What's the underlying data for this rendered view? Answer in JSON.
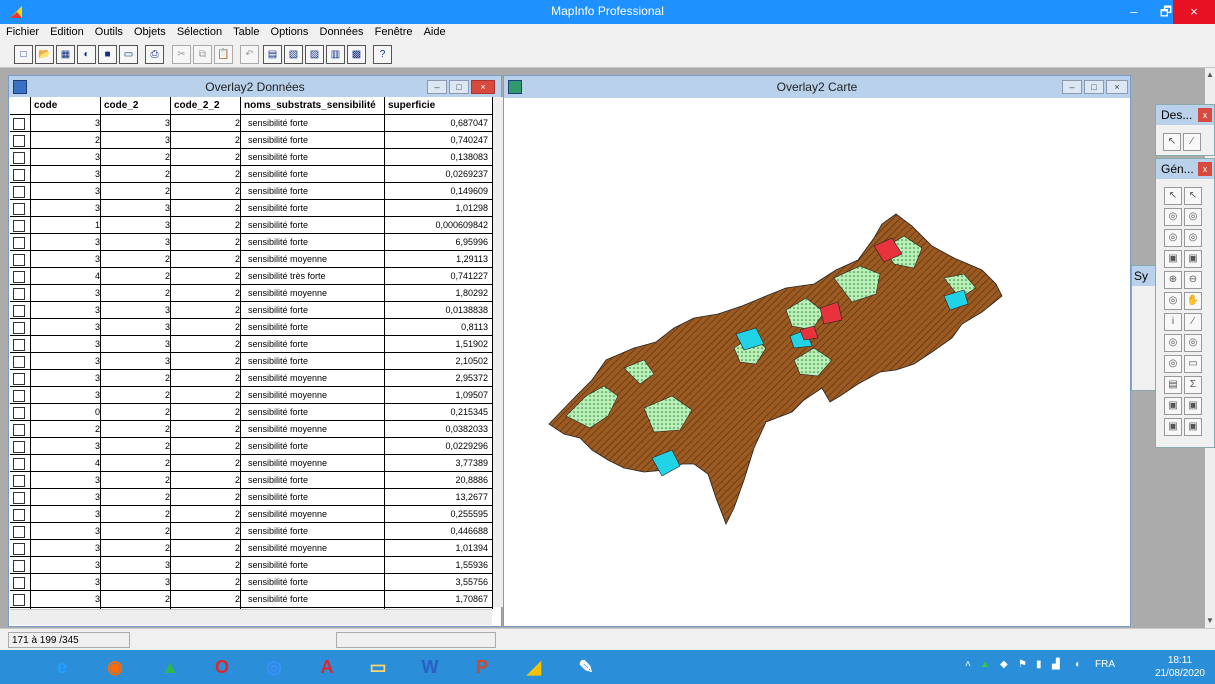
{
  "app": {
    "title": "MapInfo Professional",
    "minimize": "–",
    "maximize": "🗗",
    "close": "×"
  },
  "menu": [
    "Fichier",
    "Edition",
    "Outils",
    "Objets",
    "Sélection",
    "Table",
    "Options",
    "Données",
    "Fenêtre",
    "Aide"
  ],
  "toolbar": {
    "buttons": [
      "new-icon",
      "open-icon",
      "open-table-icon",
      "save-workspace-icon",
      "save-icon",
      "clone-icon",
      "print-icon",
      "cut-icon",
      "copy-icon",
      "paste-icon",
      "undo-icon",
      "browser-icon",
      "map-icon",
      "graph-icon",
      "layout-icon",
      "redistrict-icon",
      "help-icon"
    ],
    "glyphs": [
      "□",
      "📂",
      "▦",
      "◐",
      "■",
      "▭",
      "⎙",
      "✂",
      "⧉",
      "📋",
      "↶",
      "▤",
      "▧",
      "▨",
      "▥",
      "▩",
      "?"
    ]
  },
  "browser": {
    "title": "Overlay2 Données",
    "columns": [
      "code",
      "code_2",
      "code_2_2",
      "noms_substrats_sensibilité",
      "superficie"
    ],
    "rows": [
      [
        "3",
        "3",
        "2",
        "sensibilité  forte",
        "0,687047"
      ],
      [
        "2",
        "3",
        "2",
        "sensibilité  forte",
        "0,740247"
      ],
      [
        "3",
        "2",
        "2",
        "sensibilité  forte",
        "0,138083"
      ],
      [
        "3",
        "2",
        "2",
        "sensibilité  forte",
        "0,0269237"
      ],
      [
        "3",
        "2",
        "2",
        "sensibilité  forte",
        "0,149609"
      ],
      [
        "3",
        "3",
        "2",
        "sensibilité  forte",
        "1,01298"
      ],
      [
        "1",
        "3",
        "2",
        "sensibilité  forte",
        "0,000609842"
      ],
      [
        "3",
        "3",
        "2",
        "sensibilité  forte",
        "6,95996"
      ],
      [
        "3",
        "2",
        "2",
        "sensibilité moyenne",
        "1,29113"
      ],
      [
        "4",
        "2",
        "2",
        "sensibilité très forte",
        "0,741227"
      ],
      [
        "3",
        "2",
        "2",
        "sensibilité moyenne",
        "1,80292"
      ],
      [
        "3",
        "3",
        "2",
        "sensibilité  forte",
        "0,0138838"
      ],
      [
        "3",
        "3",
        "2",
        "sensibilité  forte",
        "0,8113"
      ],
      [
        "3",
        "3",
        "2",
        "sensibilité  forte",
        "1,51902"
      ],
      [
        "3",
        "3",
        "2",
        "sensibilité  forte",
        "2,10502"
      ],
      [
        "3",
        "2",
        "2",
        "sensibilité moyenne",
        "2,95372"
      ],
      [
        "3",
        "2",
        "2",
        "sensibilité moyenne",
        "1,09507"
      ],
      [
        "0",
        "2",
        "2",
        "sensibilité  forte",
        "0,215345"
      ],
      [
        "2",
        "2",
        "2",
        "sensibilité moyenne",
        "0,0382033"
      ],
      [
        "3",
        "2",
        "2",
        "sensibilité  forte",
        "0,0229296"
      ],
      [
        "4",
        "2",
        "2",
        "sensibilité moyenne",
        "3,77389"
      ],
      [
        "3",
        "2",
        "2",
        "sensibilité  forte",
        "20,8886"
      ],
      [
        "3",
        "2",
        "2",
        "sensibilité  forte",
        "13,2677"
      ],
      [
        "3",
        "2",
        "2",
        "sensibilité moyenne",
        "0,255595"
      ],
      [
        "3",
        "2",
        "2",
        "sensibilité  forte",
        "0,446688"
      ],
      [
        "3",
        "2",
        "2",
        "sensibilité moyenne",
        "1,01394"
      ],
      [
        "3",
        "3",
        "2",
        "sensibilité  forte",
        "1,55936"
      ],
      [
        "3",
        "3",
        "2",
        "sensibilité  forte",
        "3,55756"
      ],
      [
        "3",
        "2",
        "2",
        "sensibilité  forte",
        "1,70867"
      ]
    ]
  },
  "map": {
    "title": "Overlay2 Carte",
    "colors": {
      "brown": "#9b5a22",
      "light_green": "#b8f0b8",
      "cyan": "#22d3e6",
      "red": "#e8333c"
    }
  },
  "palettes": {
    "drawing": {
      "title": "Des...",
      "close": "x"
    },
    "general": {
      "title": "Gén...",
      "close": "x"
    },
    "symbol": {
      "title": "Sy"
    },
    "tool_glyphs": [
      "↖",
      "↖",
      "◎",
      "◎",
      "◎",
      "◎",
      "▣",
      "▣",
      "⊕",
      "⊖",
      "◎",
      "✋",
      "i",
      "∕",
      "◎",
      "◎",
      "◎",
      "▭",
      "▤",
      "Σ",
      "▣",
      "▣",
      "▣",
      "▣"
    ]
  },
  "status": {
    "selection_count": "171 à 199 /345"
  },
  "taskbar": {
    "items": [
      "ie-icon",
      "firefox-icon",
      "drive-icon",
      "opera-icon",
      "chrome-icon",
      "adobe-icon",
      "explorer-icon",
      "word-icon",
      "powerpoint-icon",
      "mapinfo-icon",
      "paint-icon"
    ],
    "glyphs": [
      "e",
      "◉",
      "▲",
      "O",
      "◎",
      "A",
      "▭",
      "W",
      "P",
      "◢",
      "✎"
    ],
    "language": "FRA",
    "time": "18:11",
    "date": "21/08/2020"
  }
}
